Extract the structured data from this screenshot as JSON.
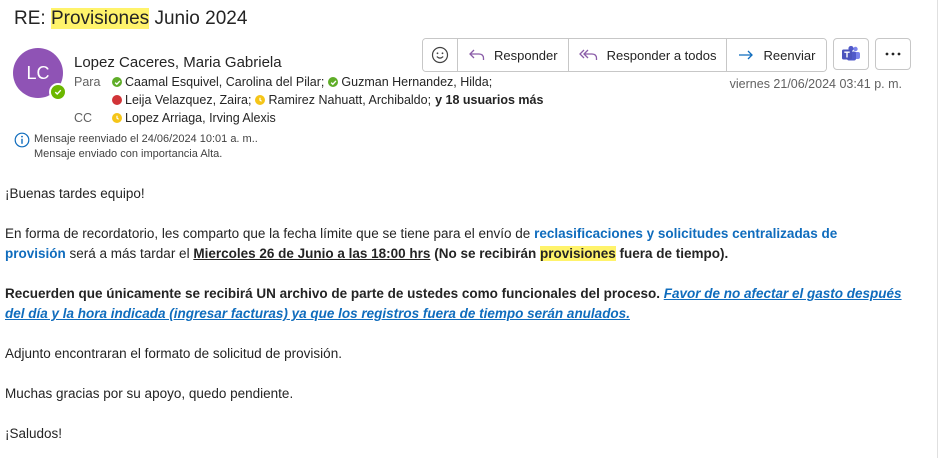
{
  "subject": {
    "prefix": "RE: ",
    "highlight": "Provisiones",
    "suffix": " Junio 2024"
  },
  "sender": {
    "initials": "LC",
    "name": "Lopez Caceres, Maria Gabriela"
  },
  "recipients": {
    "to_label": "Para",
    "to_line1": [
      {
        "name": "Caamal Esquivel, Carolina del Pilar;",
        "status": "green"
      },
      {
        "name": "Guzman Hernandez, Hilda;",
        "status": "green"
      }
    ],
    "to_line2": [
      {
        "name": "Leija Velazquez, Zaira;",
        "status": "red"
      },
      {
        "name": "Ramirez Nahuatt, Archibaldo;",
        "status": "yellow"
      }
    ],
    "more": "y 18 usuarios más",
    "cc_label": "CC",
    "cc": {
      "name": "Lopez Arriaga, Irving Alexis",
      "status": "yellow"
    }
  },
  "toolbar": {
    "reply": "Responder",
    "reply_all": "Responder a todos",
    "forward": "Reenviar"
  },
  "date": "viernes 21/06/2024 03:41 p. m.",
  "info": {
    "line1": "Mensaje reenviado el 24/06/2024 10:01 a. m..",
    "line2": "Mensaje enviado con importancia Alta."
  },
  "body": {
    "greeting": "¡Buenas tardes equipo!",
    "p1_a": "En forma de recordatorio, les comparto que la fecha límite que se tiene para el envío de ",
    "p1_b": "reclasificaciones y solicitudes centralizadas de",
    "p1_c": "provisión",
    "p1_d": " será a más tardar el ",
    "p1_e": "Miercoles 26 de Junio a las 18:00 hrs",
    "p1_f": " (No se recibirán ",
    "p1_g": "provisiones",
    "p1_h": " fuera de tiempo).",
    "p2_a": "Recuerden que únicamente se recibirá UN archivo de parte de ustedes como funcionales del proceso. ",
    "p2_b": "Favor de no afectar el gasto después",
    "p2_c": "del día y la hora indicada (ingresar facturas) ya que los registros fuera de tiempo serán anulados.",
    "p3": "Adjunto encontraran el formato de solicitud de provisión.",
    "p4": "Muchas gracias por su apoyo, quedo pendiente.",
    "p5": "¡Saludos!"
  },
  "colors": {
    "avatar": "#8f53b5",
    "presence_available": "#5fad28",
    "presence_busy": "#d13438",
    "presence_away": "#f5c518",
    "link": "#0f6cbd",
    "highlight": "#fff36b"
  }
}
